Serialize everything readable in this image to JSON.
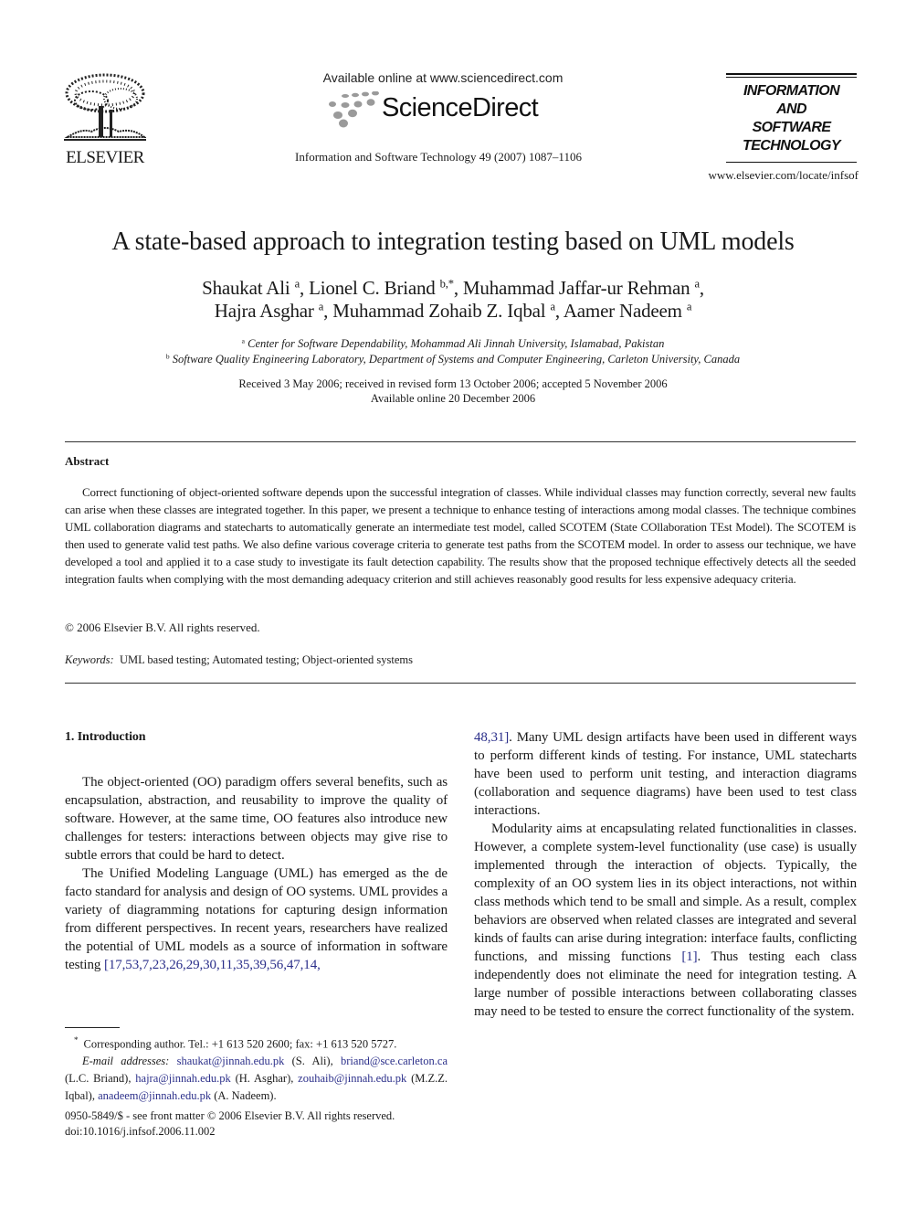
{
  "header": {
    "publisher": "ELSEVIER",
    "available_online": "Available online at www.sciencedirect.com",
    "sciencedirect": "ScienceDirect",
    "journal_citation": "Information and Software Technology 49 (2007) 1087–1106",
    "journal_name_lines": [
      "INFORMATION",
      "AND",
      "SOFTWARE",
      "TECHNOLOGY"
    ],
    "journal_url": "www.elsevier.com/locate/infsof"
  },
  "paper": {
    "title": "A state-based approach to integration testing based on UML models",
    "authors_line1": [
      {
        "name": "Shaukat Ali",
        "sup": "a",
        "sep": ", "
      },
      {
        "name": "Lionel C. Briand",
        "sup": "b,*",
        "sep": ", "
      },
      {
        "name": "Muhammad Jaffar-ur Rehman",
        "sup": "a",
        "sep": ","
      }
    ],
    "authors_line2": [
      {
        "name": "Hajra Asghar",
        "sup": "a",
        "sep": ", "
      },
      {
        "name": "Muhammad Zohaib Z. Iqbal",
        "sup": "a",
        "sep": ", "
      },
      {
        "name": "Aamer Nadeem",
        "sup": "a",
        "sep": ""
      }
    ],
    "affiliations": [
      {
        "mark": "a",
        "text": "Center for Software Dependability, Mohammad Ali Jinnah University, Islamabad, Pakistan"
      },
      {
        "mark": "b",
        "text": "Software Quality Engineering Laboratory, Department of Systems and Computer Engineering, Carleton University, Canada"
      }
    ],
    "received": "Received 3 May 2006; received in revised form 13 October 2006; accepted 5 November 2006",
    "available_online": "Available online 20 December 2006"
  },
  "abstract": {
    "heading": "Abstract",
    "text": "Correct functioning of object-oriented software depends upon the successful integration of classes. While individual classes may function correctly, several new faults can arise when these classes are integrated together. In this paper, we present a technique to enhance testing of interactions among modal classes. The technique combines UML collaboration diagrams and statecharts to automatically generate an intermediate test model, called SCOTEM (State COllaboration TEst Model). The SCOTEM is then used to generate valid test paths. We also define various coverage criteria to generate test paths from the SCOTEM model. In order to assess our technique, we have developed a tool and applied it to a case study to investigate its fault detection capability. The results show that the proposed technique effectively detects all the seeded integration faults when complying with the most demanding adequacy criterion and still achieves reasonably good results for less expensive adequacy criteria.",
    "copyright": "© 2006 Elsevier B.V. All rights reserved.",
    "keywords_label": "Keywords:",
    "keywords": "UML based testing; Automated testing; Object-oriented systems"
  },
  "body": {
    "section_heading": "1. Introduction",
    "left": {
      "p1": "The object-oriented (OO) paradigm offers several benefits, such as encapsulation, abstraction, and reusability to improve the quality of software. However, at the same time, OO features also introduce new challenges for testers: interactions between objects may give rise to subtle errors that could be hard to detect.",
      "p2": "The Unified Modeling Language (UML) has emerged as the de facto standard for analysis and design of OO systems. UML provides a variety of diagramming notations for capturing design information from different perspectives. In recent years, researchers have realized the potential of UML models as a source of information in software testing ",
      "p2_cite": "[17,53,7,23,26,29,30,11,35,39,56,47,14,"
    },
    "right": {
      "p1_cite": "48,31]",
      "p1": ". Many UML design artifacts have been used in different ways to perform different kinds of testing. For instance, UML statecharts have been used to perform unit testing, and interaction diagrams (collaboration and sequence diagrams) have been used to test class interactions.",
      "p2_before": "Modularity aims at encapsulating related functionalities in classes. However, a complete system-level functionality (use case) is usually implemented through the interaction of objects. Typically, the complexity of an OO system lies in its object interactions, not within class methods which tend to be small and simple. As a result, complex behaviors are observed when related classes are integrated and several kinds of faults can arise during integration: interface faults, conflicting functions, and missing functions ",
      "p2_cite": "[1]",
      "p2_after": ". Thus testing each class independently does not eliminate the need for integration testing. A large number of possible interactions between collaborating classes may need to be tested to ensure the correct functionality of the system."
    }
  },
  "footnote": {
    "mark": "*",
    "corresponding": "Corresponding author. Tel.: +1 613 520 2600; fax: +1 613 520 5727.",
    "email_label": "E-mail addresses:",
    "emails": [
      {
        "email": "shaukat@jinnah.edu.pk",
        "owner": " (S. Ali), "
      },
      {
        "email": "briand@sce.carleton.ca",
        "owner": " (L.C. Briand), "
      },
      {
        "email": "hajra@jinnah.edu.pk",
        "owner": " (H. Asghar), "
      },
      {
        "email": "zouhaib@jinnah.edu.pk",
        "owner": " (M.Z.Z. Iqbal), "
      },
      {
        "email": "anadeem@jinnah.edu.pk",
        "owner": " (A. Nadeem)."
      }
    ],
    "issn": "0950-5849/$ - see front matter © 2006 Elsevier B.V. All rights reserved.",
    "doi": "doi:10.1016/j.infsof.2006.11.002"
  },
  "colors": {
    "link": "#2b2f8a",
    "text": "#1a1a1a"
  }
}
